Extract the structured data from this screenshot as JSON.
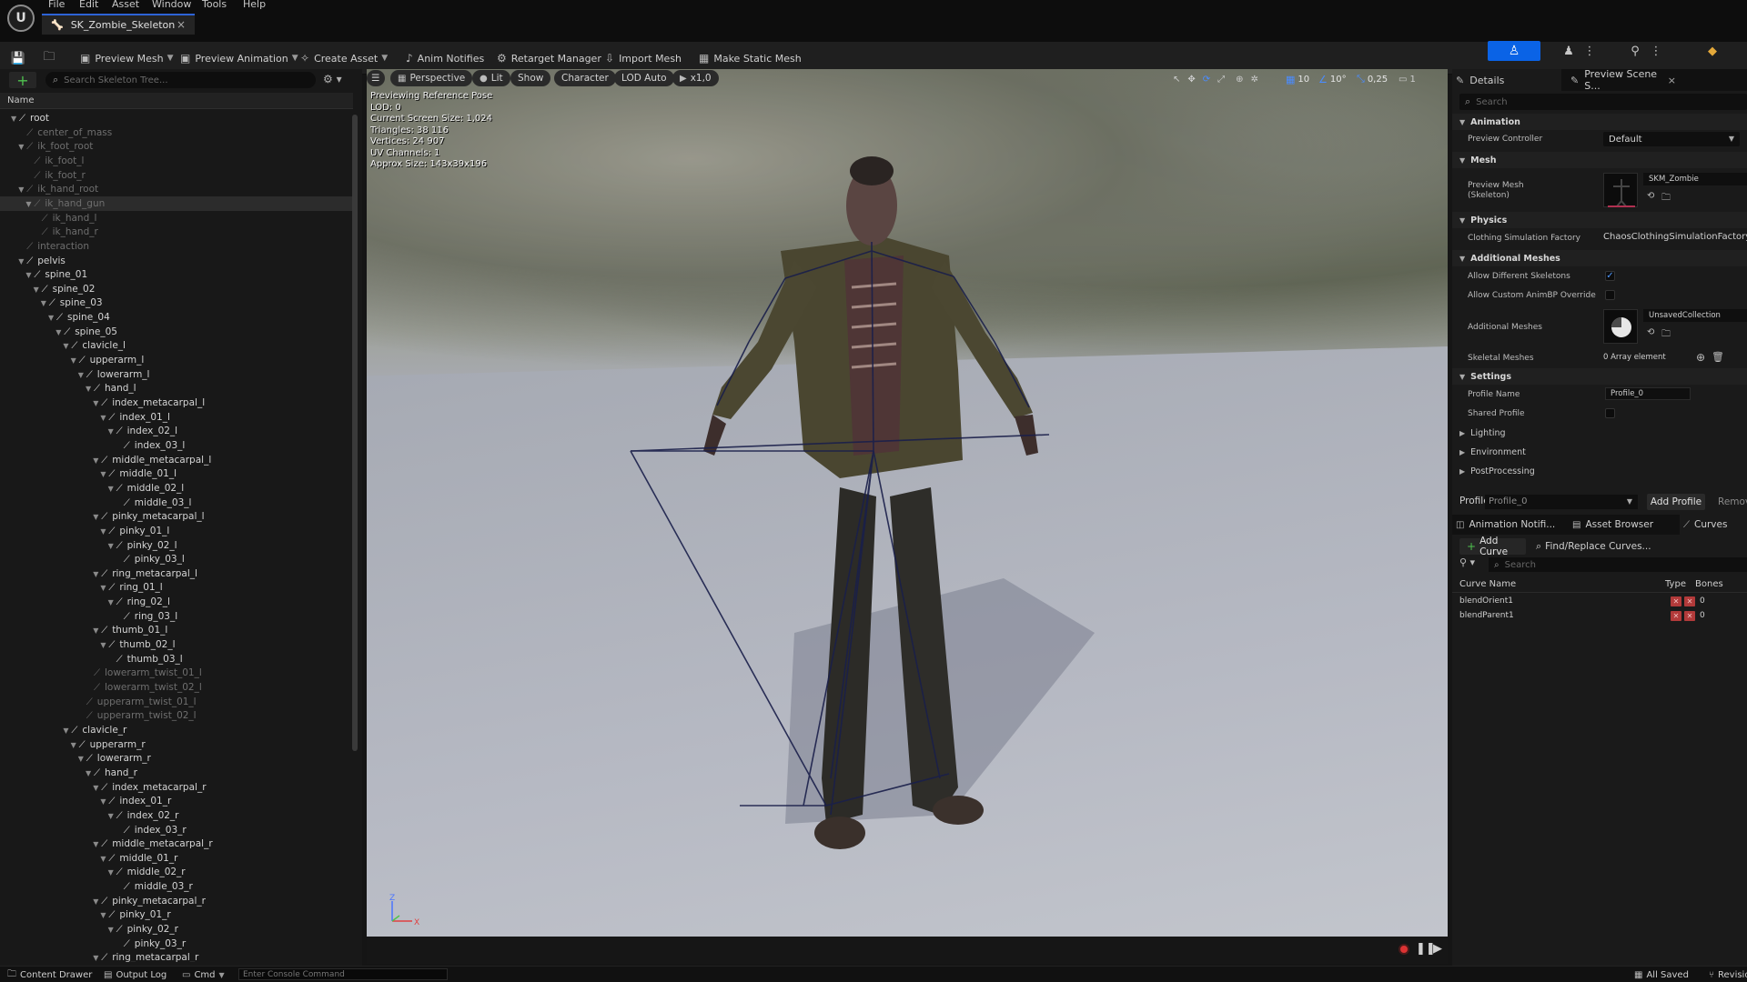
{
  "menu": {
    "logo": "U",
    "items": [
      "File",
      "Edit",
      "Asset",
      "Window",
      "Tools",
      "Help"
    ]
  },
  "tab": {
    "title": "SK_Zombie_Skeleton",
    "close": "×"
  },
  "toolbar": {
    "preview_mesh": "Preview Mesh",
    "preview_animation": "Preview Animation",
    "create_asset": "Create Asset",
    "anim_notifies": "Anim Notifies",
    "retarget_manager": "Retarget Manager",
    "import_mesh": "Import Mesh",
    "make_static_mesh": "Make Static Mesh"
  },
  "skeleton_tree": {
    "search_placeholder": "Search Skeleton Tree...",
    "column_name": "Name",
    "bones": [
      {
        "name": "root",
        "depth": 0,
        "style": "normal",
        "expand": "▼"
      },
      {
        "name": "center_of_mass",
        "depth": 1,
        "style": "virt",
        "expand": ""
      },
      {
        "name": "ik_foot_root",
        "depth": 1,
        "style": "virt",
        "expand": "▼"
      },
      {
        "name": "ik_foot_l",
        "depth": 2,
        "style": "virt",
        "expand": ""
      },
      {
        "name": "ik_foot_r",
        "depth": 2,
        "style": "virt",
        "expand": ""
      },
      {
        "name": "ik_hand_root",
        "depth": 1,
        "style": "virt",
        "expand": "▼"
      },
      {
        "name": "ik_hand_gun",
        "depth": 2,
        "style": "virt",
        "expand": "▼",
        "selected": true
      },
      {
        "name": "ik_hand_l",
        "depth": 3,
        "style": "virt",
        "expand": ""
      },
      {
        "name": "ik_hand_r",
        "depth": 3,
        "style": "virt",
        "expand": ""
      },
      {
        "name": "interaction",
        "depth": 1,
        "style": "virt",
        "expand": ""
      },
      {
        "name": "pelvis",
        "depth": 1,
        "style": "normal",
        "expand": "▼"
      },
      {
        "name": "spine_01",
        "depth": 2,
        "style": "normal",
        "expand": "▼"
      },
      {
        "name": "spine_02",
        "depth": 3,
        "style": "normal",
        "expand": "▼"
      },
      {
        "name": "spine_03",
        "depth": 4,
        "style": "normal",
        "expand": "▼"
      },
      {
        "name": "spine_04",
        "depth": 5,
        "style": "normal",
        "expand": "▼"
      },
      {
        "name": "spine_05",
        "depth": 6,
        "style": "normal",
        "expand": "▼"
      },
      {
        "name": "clavicle_l",
        "depth": 7,
        "style": "normal",
        "expand": "▼"
      },
      {
        "name": "upperarm_l",
        "depth": 8,
        "style": "normal",
        "expand": "▼"
      },
      {
        "name": "lowerarm_l",
        "depth": 9,
        "style": "normal",
        "expand": "▼"
      },
      {
        "name": "hand_l",
        "depth": 10,
        "style": "normal",
        "expand": "▼"
      },
      {
        "name": "index_metacarpal_l",
        "depth": 11,
        "style": "normal",
        "expand": "▼"
      },
      {
        "name": "index_01_l",
        "depth": 12,
        "style": "normal",
        "expand": "▼"
      },
      {
        "name": "index_02_l",
        "depth": 13,
        "style": "normal",
        "expand": "▼"
      },
      {
        "name": "index_03_l",
        "depth": 14,
        "style": "normal",
        "expand": ""
      },
      {
        "name": "middle_metacarpal_l",
        "depth": 11,
        "style": "normal",
        "expand": "▼"
      },
      {
        "name": "middle_01_l",
        "depth": 12,
        "style": "normal",
        "expand": "▼"
      },
      {
        "name": "middle_02_l",
        "depth": 13,
        "style": "normal",
        "expand": "▼"
      },
      {
        "name": "middle_03_l",
        "depth": 14,
        "style": "normal",
        "expand": ""
      },
      {
        "name": "pinky_metacarpal_l",
        "depth": 11,
        "style": "normal",
        "expand": "▼"
      },
      {
        "name": "pinky_01_l",
        "depth": 12,
        "style": "normal",
        "expand": "▼"
      },
      {
        "name": "pinky_02_l",
        "depth": 13,
        "style": "normal",
        "expand": "▼"
      },
      {
        "name": "pinky_03_l",
        "depth": 14,
        "style": "normal",
        "expand": ""
      },
      {
        "name": "ring_metacarpal_l",
        "depth": 11,
        "style": "normal",
        "expand": "▼"
      },
      {
        "name": "ring_01_l",
        "depth": 12,
        "style": "normal",
        "expand": "▼"
      },
      {
        "name": "ring_02_l",
        "depth": 13,
        "style": "normal",
        "expand": "▼"
      },
      {
        "name": "ring_03_l",
        "depth": 14,
        "style": "normal",
        "expand": ""
      },
      {
        "name": "thumb_01_l",
        "depth": 11,
        "style": "normal",
        "expand": "▼"
      },
      {
        "name": "thumb_02_l",
        "depth": 12,
        "style": "normal",
        "expand": "▼"
      },
      {
        "name": "thumb_03_l",
        "depth": 13,
        "style": "normal",
        "expand": ""
      },
      {
        "name": "lowerarm_twist_01_l",
        "depth": 10,
        "style": "virt",
        "expand": ""
      },
      {
        "name": "lowerarm_twist_02_l",
        "depth": 10,
        "style": "virt",
        "expand": ""
      },
      {
        "name": "upperarm_twist_01_l",
        "depth": 9,
        "style": "virt",
        "expand": ""
      },
      {
        "name": "upperarm_twist_02_l",
        "depth": 9,
        "style": "virt",
        "expand": ""
      },
      {
        "name": "clavicle_r",
        "depth": 7,
        "style": "normal",
        "expand": "▼"
      },
      {
        "name": "upperarm_r",
        "depth": 8,
        "style": "normal",
        "expand": "▼"
      },
      {
        "name": "lowerarm_r",
        "depth": 9,
        "style": "normal",
        "expand": "▼"
      },
      {
        "name": "hand_r",
        "depth": 10,
        "style": "normal",
        "expand": "▼"
      },
      {
        "name": "index_metacarpal_r",
        "depth": 11,
        "style": "normal",
        "expand": "▼"
      },
      {
        "name": "index_01_r",
        "depth": 12,
        "style": "normal",
        "expand": "▼"
      },
      {
        "name": "index_02_r",
        "depth": 13,
        "style": "normal",
        "expand": "▼"
      },
      {
        "name": "index_03_r",
        "depth": 14,
        "style": "normal",
        "expand": ""
      },
      {
        "name": "middle_metacarpal_r",
        "depth": 11,
        "style": "normal",
        "expand": "▼"
      },
      {
        "name": "middle_01_r",
        "depth": 12,
        "style": "normal",
        "expand": "▼"
      },
      {
        "name": "middle_02_r",
        "depth": 13,
        "style": "normal",
        "expand": "▼"
      },
      {
        "name": "middle_03_r",
        "depth": 14,
        "style": "normal",
        "expand": ""
      },
      {
        "name": "pinky_metacarpal_r",
        "depth": 11,
        "style": "normal",
        "expand": "▼"
      },
      {
        "name": "pinky_01_r",
        "depth": 12,
        "style": "normal",
        "expand": "▼"
      },
      {
        "name": "pinky_02_r",
        "depth": 13,
        "style": "normal",
        "expand": "▼"
      },
      {
        "name": "pinky_03_r",
        "depth": 14,
        "style": "normal",
        "expand": ""
      },
      {
        "name": "ring_metacarpal_r",
        "depth": 11,
        "style": "normal",
        "expand": "▼"
      }
    ]
  },
  "viewport": {
    "toolbar": {
      "perspective": "Perspective",
      "lit": "Lit",
      "show": "Show",
      "character": "Character",
      "lod": "LOD Auto",
      "play_rate": "x1,0",
      "grid_size": "10",
      "rotation_snap": "10°",
      "scale_snap": "0,25",
      "camera_speed": "1"
    },
    "info": [
      "Previewing Reference Pose",
      "LOD: 0",
      "Current Screen Size: 1,024",
      "Triangles: 38 116",
      "Vertices: 24 907",
      "UV Channels: 1",
      "Approx Size: 143x39x196"
    ],
    "axis": {
      "z": "Z",
      "x": "X"
    }
  },
  "details": {
    "tab_details": "Details",
    "tab_preview_scene": "Preview Scene S...",
    "search_placeholder": "Search",
    "sections": {
      "animation": "Animation",
      "mesh": "Mesh",
      "physics": "Physics",
      "additional_meshes": "Additional Meshes",
      "settings": "Settings",
      "lighting": "Lighting",
      "environment": "Environment",
      "post_processing": "PostProcessing"
    },
    "preview_controller_label": "Preview Controller",
    "preview_controller_value": "Default",
    "preview_mesh_label": "Preview Mesh\n(Skeleton)",
    "preview_mesh_value": "SKM_Zombie",
    "clothing_factory_label": "Clothing Simulation Factory",
    "clothing_factory_value": "ChaosClothingSimulationFactory",
    "allow_diff_skeletons_label": "Allow Different Skeletons",
    "allow_diff_skeletons": true,
    "allow_custom_animbp_label": "Allow Custom AnimBP Override",
    "allow_custom_animbp": false,
    "additional_meshes_label": "Additional Meshes",
    "additional_meshes_value": "UnsavedCollection",
    "skeletal_meshes_label": "Skeletal Meshes",
    "skeletal_meshes_value": "0 Array element",
    "profile_name_label": "Profile Name",
    "profile_name_value": "Profile_0",
    "shared_profile_label": "Shared Profile",
    "shared_profile": false
  },
  "profile_bar": {
    "label": "Profile",
    "selected": "Profile_0",
    "add": "Add Profile",
    "remove": "Remove Profile"
  },
  "curves_panel": {
    "tab_anim_notifies": "Animation Notifi...",
    "tab_asset_browser": "Asset Browser",
    "tab_curves": "Curves",
    "add_curve": "Add Curve",
    "find_replace": "Find/Replace Curves...",
    "search_placeholder": "Search",
    "col_name": "Curve Name",
    "col_type": "Type",
    "col_bones": "Bones",
    "rows": [
      {
        "name": "blendOrient1",
        "bones": "0"
      },
      {
        "name": "blendParent1",
        "bones": "0"
      }
    ]
  },
  "statusbar": {
    "content_drawer": "Content Drawer",
    "output_log": "Output Log",
    "cmd": "Cmd",
    "console_placeholder": "Enter Console Command",
    "all_saved": "All Saved",
    "revision": "Revision Control"
  }
}
